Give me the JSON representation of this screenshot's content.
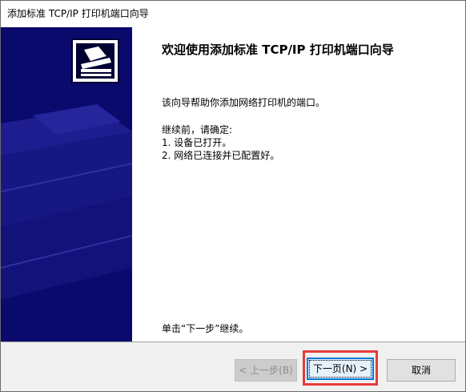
{
  "window": {
    "title": "添加标准 TCP/IP 打印机端口向导"
  },
  "main": {
    "heading": "欢迎使用添加标准 TCP/IP 打印机端口向导",
    "intro": "该向导帮助你添加网络打印机的端口。",
    "prereq_title": "继续前，请确定:",
    "prereq_items": [
      "1.  设备已打开。",
      "2.  网络已连接并已配置好。"
    ],
    "continue_hint": "单击“下一步”继续。"
  },
  "footer": {
    "back_label": "< 上一步(B)",
    "next_label": "下一页(N) >",
    "cancel_label": "取消"
  },
  "colors": {
    "banner": "#0b0b72",
    "highlight": "#e63b3b",
    "accent": "#0078d7"
  }
}
